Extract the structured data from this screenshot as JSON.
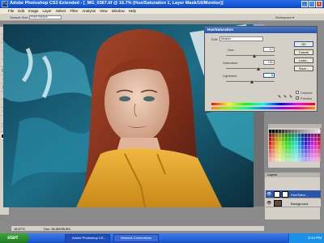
{
  "window": {
    "title": "Adobe Photoshop CS3 Extended - [_MG_0367.tif @ 16.7% (Hue/Saturation 1, Layer Mask/16/Monitor)]",
    "min_label": "_",
    "max_label": "□",
    "close_label": "x",
    "app_icon_label": "Ps"
  },
  "menu": [
    "File",
    "Edit",
    "Image",
    "Layer",
    "Select",
    "Filter",
    "Analysis",
    "View",
    "Window",
    "Help"
  ],
  "options_bar": {
    "sample_size_label": "Sample Size:",
    "sample_size_value": "Point Sample",
    "workspace_label": "Workspace ▾"
  },
  "tools": [
    "▸",
    "⬚",
    "⌖",
    "✂",
    "✎",
    "⌫",
    "◍",
    "▤",
    "✒",
    "T",
    "⬡",
    "☜",
    "🔍"
  ],
  "document": {
    "title": "_MG_0367.tif @ 16.7%",
    "zoom": "16.67%",
    "doc_size": "Doc: 56.8M/95.8M"
  },
  "dialog": {
    "title": "Hue/Saturation",
    "edit_label": "Edit:",
    "edit_value": "Master",
    "hue_label": "Hue:",
    "hue_value": "17",
    "saturation_label": "Saturation:",
    "saturation_value": "+31",
    "lightness_label": "Lightness:",
    "lightness_value": "5",
    "ok_label": "OK",
    "cancel_label": "Cancel",
    "load_label": "Load...",
    "save_label": "Save...",
    "colorize_label": "Colorize",
    "preview_label": "Preview"
  },
  "layers": {
    "tab_label": "Layers",
    "items": [
      {
        "name": "Hue/Satur..."
      },
      {
        "name": "Background"
      }
    ]
  },
  "taskbar": {
    "start_label": "start",
    "items": [
      "Adobe Photoshop CS...",
      "Network Connections"
    ],
    "clock": "3:14 PM"
  }
}
